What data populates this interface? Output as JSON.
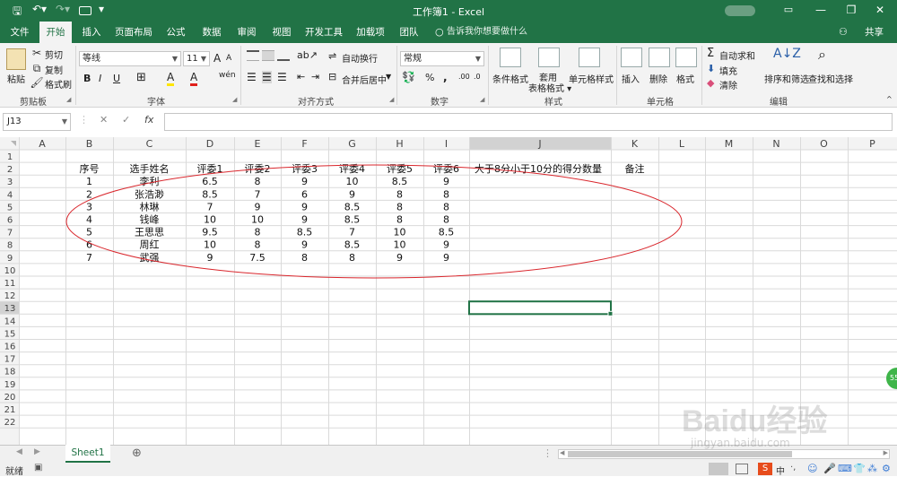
{
  "window": {
    "title": "工作簿1  -  Excel",
    "minimize": "—",
    "restore": "❐",
    "close": "✕"
  },
  "quick_access": {
    "save": "🖫",
    "undo": "↶▾",
    "redo": "↷▾",
    "customize": "▾"
  },
  "tabs": [
    "文件",
    "开始",
    "插入",
    "页面布局",
    "公式",
    "数据",
    "审阅",
    "视图",
    "开发工具",
    "加载项",
    "团队"
  ],
  "tell_me": "告诉我你想要做什么",
  "share": "共享",
  "ribbon": {
    "clipboard": {
      "label": "剪贴板",
      "paste": "粘贴",
      "cut": "剪切",
      "copy": "复制",
      "format_painter": "格式刷"
    },
    "font": {
      "label": "字体",
      "font_name": "等线",
      "font_size": "11",
      "bold": "B",
      "italic": "I",
      "underline": "U",
      "grow": "A",
      "shrink": "A",
      "fill": "A",
      "color": "A",
      "border": "⊞",
      "wen": "wén"
    },
    "alignment": {
      "label": "对齐方式",
      "wrap": "自动换行",
      "merge": "合并后居中"
    },
    "number": {
      "label": "数字",
      "format": "常规",
      "percent": "%",
      "comma": ",",
      "inc": ".00",
      "dec": ".0"
    },
    "styles": {
      "label": "样式",
      "conditional": "条件格式",
      "as_table": "套用\n表格格式",
      "cell_styles": "单元格样式"
    },
    "cells": {
      "label": "单元格",
      "insert": "插入",
      "delete": "删除",
      "format": "格式"
    },
    "editing": {
      "label": "编辑",
      "autosum": "自动求和",
      "fill": "填充",
      "clear": "清除",
      "sort": "排序和筛选",
      "find": "查找和选择"
    }
  },
  "formula_bar": {
    "name_box": "J13",
    "cancel": "✕",
    "enter": "✓",
    "fx": "fx",
    "value": ""
  },
  "columns": [
    "A",
    "B",
    "C",
    "D",
    "E",
    "F",
    "G",
    "H",
    "I",
    "J",
    "K",
    "L",
    "M",
    "N",
    "O",
    "P"
  ],
  "rows": [
    "1",
    "2",
    "3",
    "4",
    "5",
    "6",
    "7",
    "8",
    "9",
    "10",
    "11",
    "12",
    "13",
    "14",
    "15",
    "16",
    "17",
    "18",
    "19",
    "20",
    "21",
    "22"
  ],
  "cells": {
    "2": {
      "B": "序号",
      "C": "选手姓名",
      "D": "评委1",
      "E": "评委2",
      "F": "评委3",
      "G": "评委4",
      "H": "评委5",
      "I": "评委6",
      "J": "大于8分小于10分的得分数量",
      "K": "备注"
    },
    "3": {
      "B": "1",
      "C": "李利",
      "D": "6.5",
      "E": "8",
      "F": "9",
      "G": "10",
      "H": "8.5",
      "I": "9"
    },
    "4": {
      "B": "2",
      "C": "张浩渺",
      "D": "8.5",
      "E": "7",
      "F": "6",
      "G": "9",
      "H": "8",
      "I": "8"
    },
    "5": {
      "B": "3",
      "C": "林琳",
      "D": "7",
      "E": "9",
      "F": "9",
      "G": "8.5",
      "H": "8",
      "I": "8"
    },
    "6": {
      "B": "4",
      "C": "钱峰",
      "D": "10",
      "E": "10",
      "F": "9",
      "G": "8.5",
      "H": "8",
      "I": "8"
    },
    "7": {
      "B": "5",
      "C": "王思思",
      "D": "9.5",
      "E": "8",
      "F": "8.5",
      "G": "7",
      "H": "10",
      "I": "8.5"
    },
    "8": {
      "B": "6",
      "C": "周红",
      "D": "10",
      "E": "8",
      "F": "9",
      "G": "8.5",
      "H": "10",
      "I": "9"
    },
    "9": {
      "B": "7",
      "C": "武强",
      "D": "9",
      "E": "7.5",
      "F": "8",
      "G": "8",
      "H": "9",
      "I": "9"
    }
  },
  "selected_cell": "J13",
  "annotation_color": "#d9262c",
  "accent_color": "#217346",
  "sheet_tabs": [
    "Sheet1"
  ],
  "add_sheet": "⊕",
  "status": {
    "ready": "就绪",
    "ime": "中"
  },
  "watermark": {
    "brand": "Baidu经验",
    "url": "jingyan.baidu.com"
  }
}
